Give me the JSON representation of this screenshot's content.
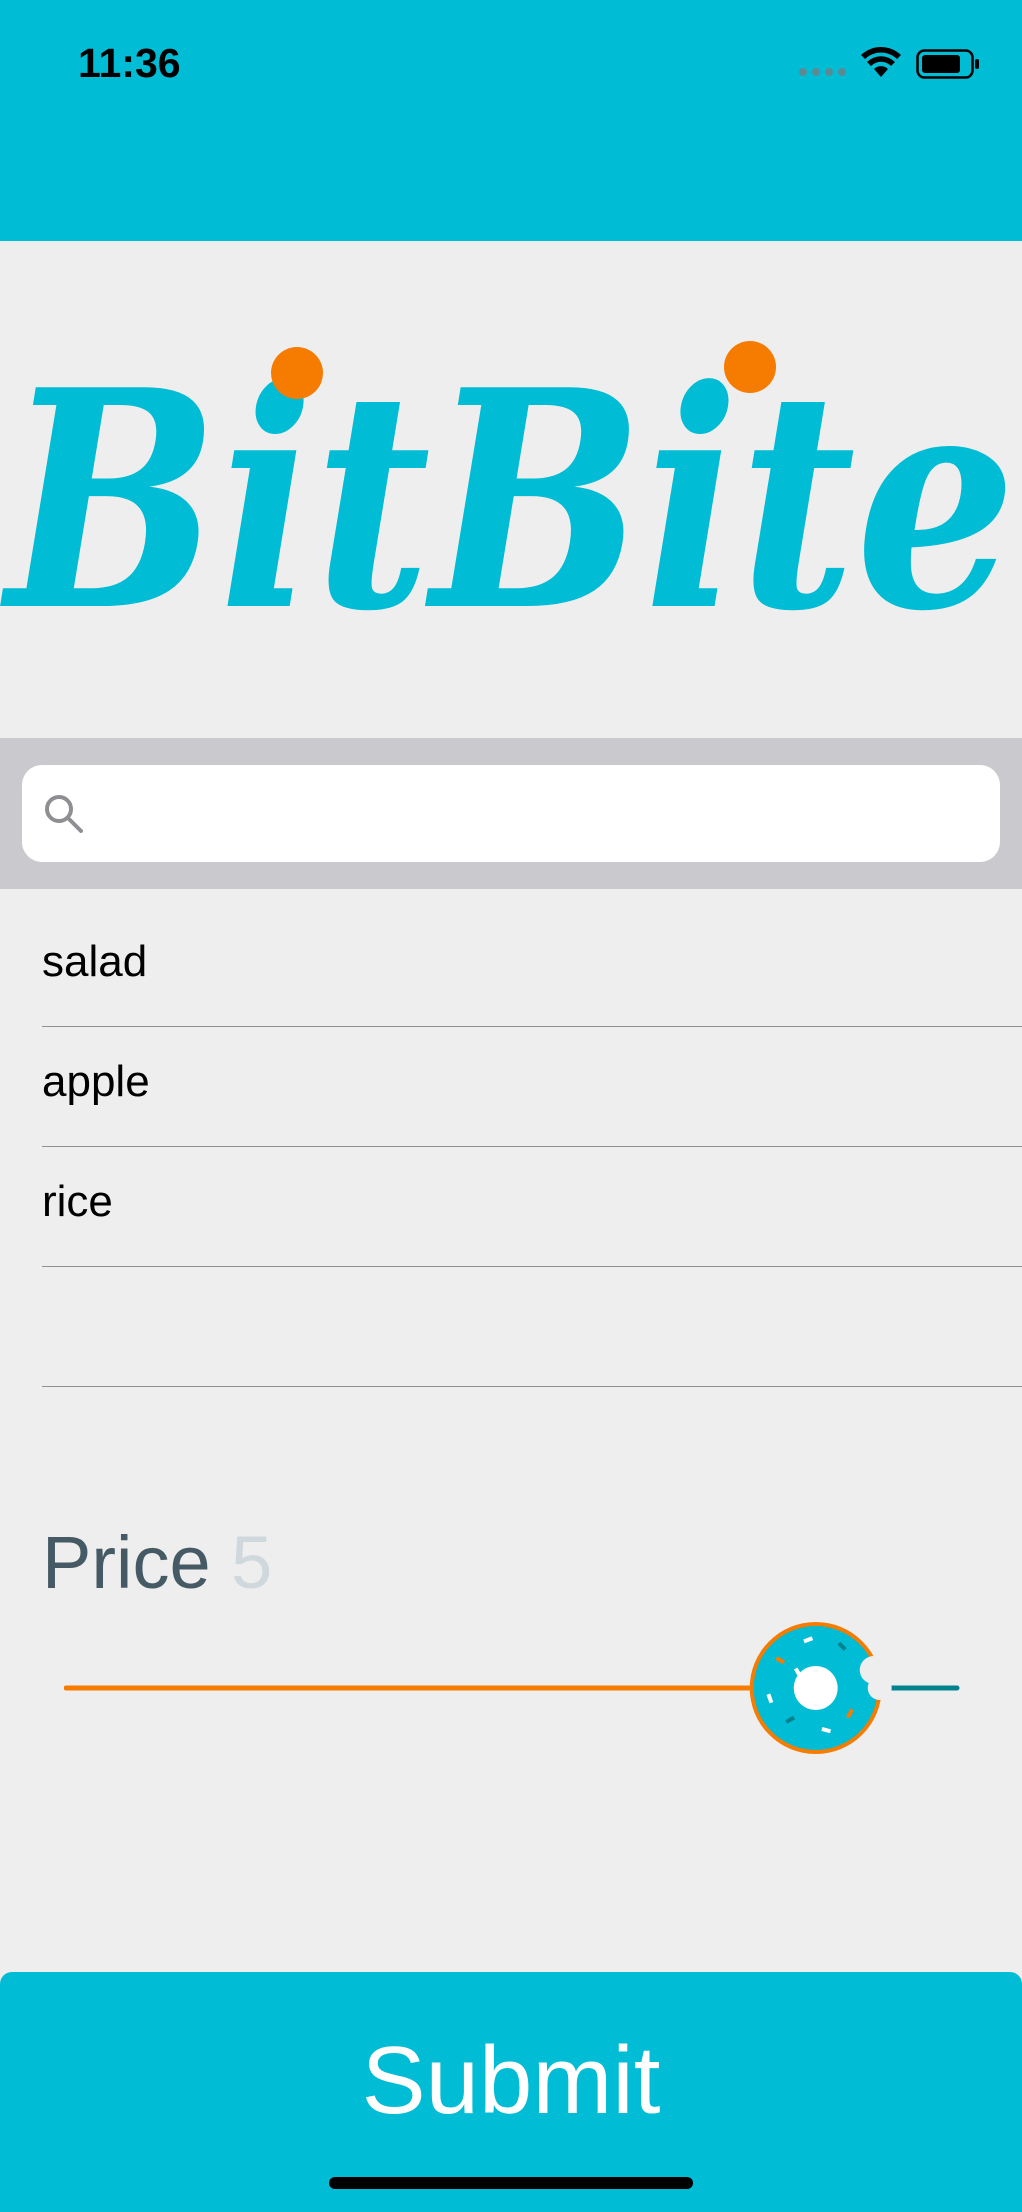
{
  "status_bar": {
    "time": "11:36"
  },
  "logo": {
    "text": "BitBite"
  },
  "search": {
    "placeholder": "",
    "value": ""
  },
  "list": {
    "items": [
      {
        "label": "salad"
      },
      {
        "label": "apple"
      },
      {
        "label": "rice"
      },
      {
        "label": ""
      }
    ]
  },
  "price": {
    "label": "Price",
    "value": "5",
    "slider_fraction": 0.92
  },
  "submit": {
    "label": "Submit"
  },
  "colors": {
    "primary": "#00bcd4",
    "accent": "#f57c00",
    "background": "#eeeeee",
    "price_label": "#455a64",
    "price_value": "#cfd8dc"
  },
  "icons": {
    "search": "magnifier-icon",
    "wifi": "wifi-icon",
    "battery": "battery-icon",
    "signal": "cellular-signal-icon",
    "slider_thumb": "donut-icon"
  }
}
